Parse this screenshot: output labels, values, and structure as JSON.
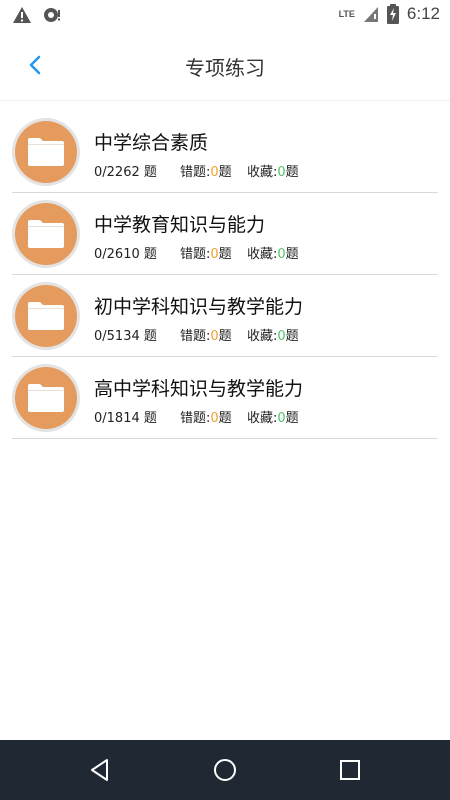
{
  "status_bar": {
    "time": "6:12",
    "network": "LTE",
    "icons": [
      "warning-icon",
      "sync-icon",
      "signal-icon",
      "battery-icon"
    ]
  },
  "header": {
    "title": "专项练习",
    "back_icon": "chevron-left-icon"
  },
  "colors": {
    "accent": "#2196f3",
    "avatar": "#e69b5e",
    "wrong_count": "#f0a030",
    "favorite_count": "#4fc36a",
    "nav_bar": "#1f2833"
  },
  "list": [
    {
      "title": "中学综合素质",
      "progress": "0/2262 题",
      "wrong_label": "错题:",
      "wrong_count": "0",
      "wrong_unit": "题",
      "fav_label": "收藏:",
      "fav_count": "0",
      "fav_unit": "题"
    },
    {
      "title": "中学教育知识与能力",
      "progress": "0/2610 题",
      "wrong_label": "错题:",
      "wrong_count": "0",
      "wrong_unit": "题",
      "fav_label": "收藏:",
      "fav_count": "0",
      "fav_unit": "题"
    },
    {
      "title": "初中学科知识与教学能力",
      "progress": "0/5134 题",
      "wrong_label": "错题:",
      "wrong_count": "0",
      "wrong_unit": "题",
      "fav_label": "收藏:",
      "fav_count": "0",
      "fav_unit": "题"
    },
    {
      "title": "高中学科知识与教学能力",
      "progress": "0/1814 题",
      "wrong_label": "错题:",
      "wrong_count": "0",
      "wrong_unit": "题",
      "fav_label": "收藏:",
      "fav_count": "0",
      "fav_unit": "题"
    }
  ],
  "nav_bar": {
    "icons": [
      "back-triangle-icon",
      "home-circle-icon",
      "recents-square-icon"
    ]
  }
}
